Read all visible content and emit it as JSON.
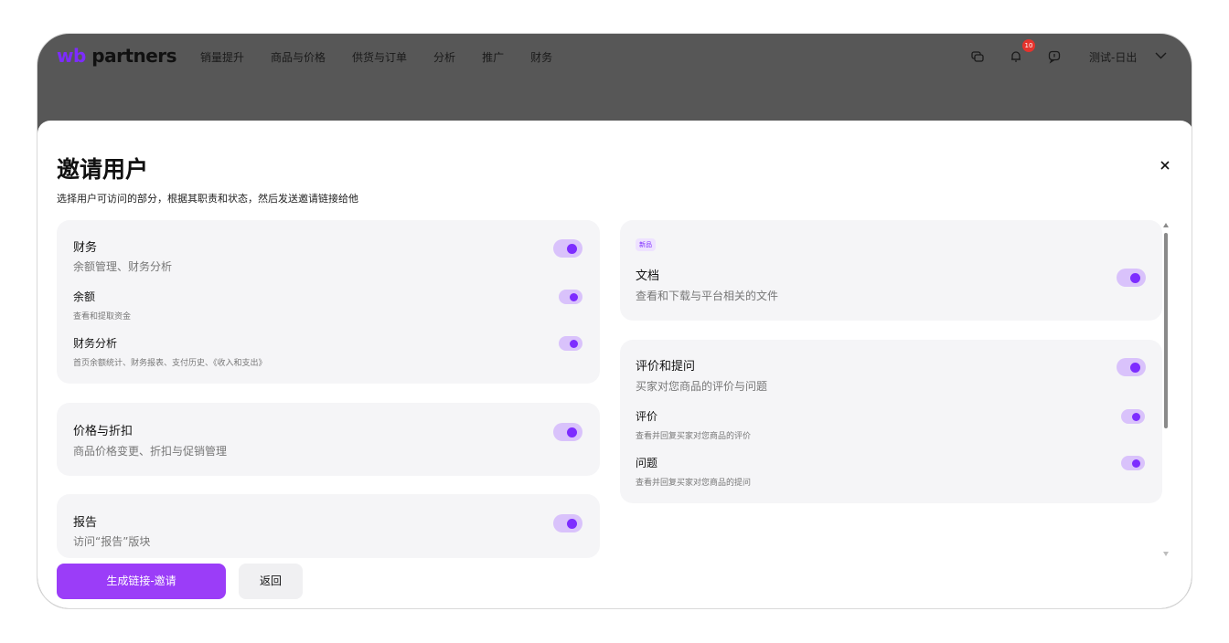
{
  "brand": {
    "wb": "wb",
    "partners": "partners",
    "accent": "#7d2cff"
  },
  "nav": [
    "销量提升",
    "商品与价格",
    "供货与订单",
    "分析",
    "推广",
    "财务"
  ],
  "tools": {
    "notification_count": "10"
  },
  "user": {
    "name": "测试-日出"
  },
  "modal": {
    "title": "邀请用户",
    "subtitle": "选择用户可访问的部分，根据其职责和状态，然后发送邀请链接给他"
  },
  "cards": {
    "finance": {
      "title": "财务",
      "desc": "余额管理、财务分析",
      "subs": [
        {
          "title": "余额",
          "desc": "查看和提取资金"
        },
        {
          "title": "财务分析",
          "desc": "首页余额统计、财务报表、支付历史、《收入和支出》"
        }
      ]
    },
    "price": {
      "title": "价格与折扣",
      "desc": "商品价格变更、折扣与促销管理"
    },
    "report": {
      "title": "报告",
      "desc": "访问“报告”版块"
    },
    "docs": {
      "tag": "新品",
      "title": "文档",
      "desc": "查看和下载与平台相关的文件"
    },
    "reviews": {
      "title": "评价和提问",
      "desc": "买家对您商品的评价与问题",
      "subs": [
        {
          "title": "评价",
          "desc": "查看并回复买家对您商品的评价"
        },
        {
          "title": "问题",
          "desc": "查看并回复买家对您商品的提问"
        }
      ]
    }
  },
  "buttons": {
    "generate": "生成链接-邀请",
    "back": "返回"
  }
}
